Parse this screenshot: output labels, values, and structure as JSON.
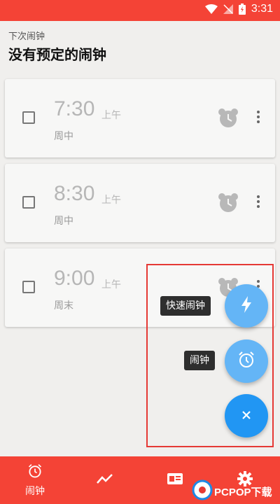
{
  "status_bar": {
    "time": "3:31"
  },
  "header": {
    "next_label": "下次闹钟",
    "title": "没有预定的闹钟"
  },
  "alarms": [
    {
      "time": "7:30",
      "ampm": "上午",
      "repeat": "周中"
    },
    {
      "time": "8:30",
      "ampm": "上午",
      "repeat": "周中"
    },
    {
      "time": "9:00",
      "ampm": "上午",
      "repeat": "周末"
    }
  ],
  "fab_menu": {
    "quick_alarm_label": "快速闹钟",
    "alarm_label": "闹钟"
  },
  "bottom_nav": {
    "items": [
      {
        "icon": "alarm-clock-icon",
        "label": "闹钟"
      },
      {
        "icon": "stats-chart-icon",
        "label": ""
      },
      {
        "icon": "id-card-icon",
        "label": ""
      },
      {
        "icon": "gear-icon",
        "label": ""
      }
    ]
  },
  "watermark": {
    "text": "PCPOP下载"
  },
  "colors": {
    "accent_red": "#f44336",
    "fab_light_blue": "#64b5f6",
    "fab_blue": "#2196f3",
    "highlight_red": "#e53935"
  }
}
